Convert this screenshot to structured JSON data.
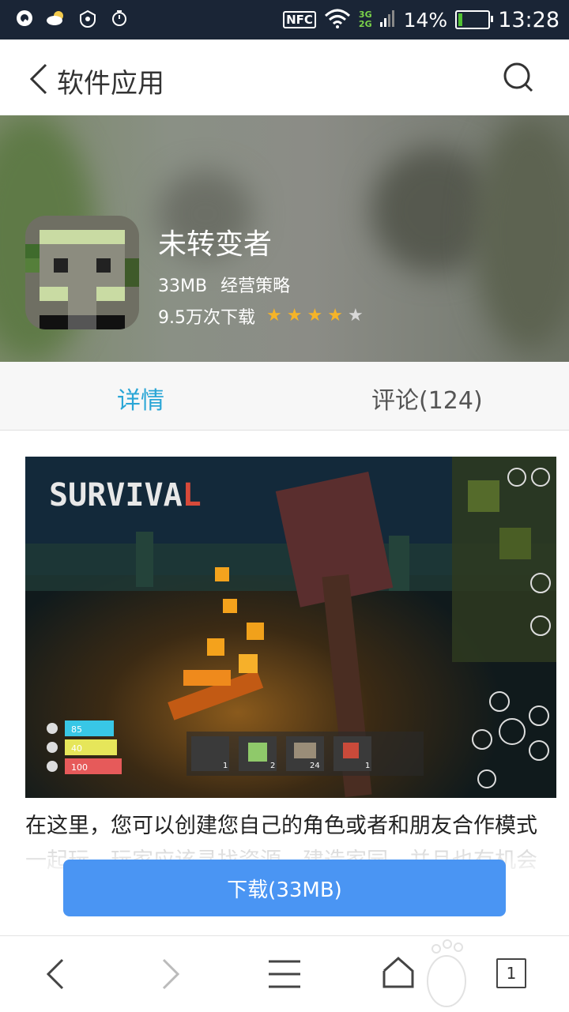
{
  "status_bar": {
    "icons": [
      "q-app-icon",
      "weather-icon",
      "sync-icon",
      "alarm-icon"
    ],
    "nfc": "NFC",
    "net_3g": "3G",
    "net_2g": "2G",
    "battery_percent": "14%",
    "battery_level": 0.14,
    "time": "13:28"
  },
  "header": {
    "title": "软件应用"
  },
  "app": {
    "name": "未转变者",
    "size": "33MB",
    "category": "经营策略",
    "downloads": "9.5万次下载",
    "rating": 4,
    "rating_max": 5
  },
  "tabs": [
    {
      "label": "详情",
      "active": true
    },
    {
      "label": "评论(124)",
      "active": false
    }
  ],
  "screenshot": {
    "title": "SURVIVAL",
    "hud_bars": [
      "85",
      "40",
      "100"
    ],
    "hotbar_counts": [
      "1",
      "2",
      "24",
      "1"
    ]
  },
  "description": "在这里，您可以创建您自己的角色或者和朋友合作模式一起玩，玩家应该寻找资源，建造家园，并且也有机会",
  "download_button": "下载(33MB)",
  "bottom_nav": {
    "tab_count": "1"
  },
  "colors": {
    "accent": "#2aa6d6",
    "download": "#4a95f3",
    "star": "#f5b428",
    "star_empty": "#d8d8d8",
    "statusbar": "#1a2536"
  }
}
